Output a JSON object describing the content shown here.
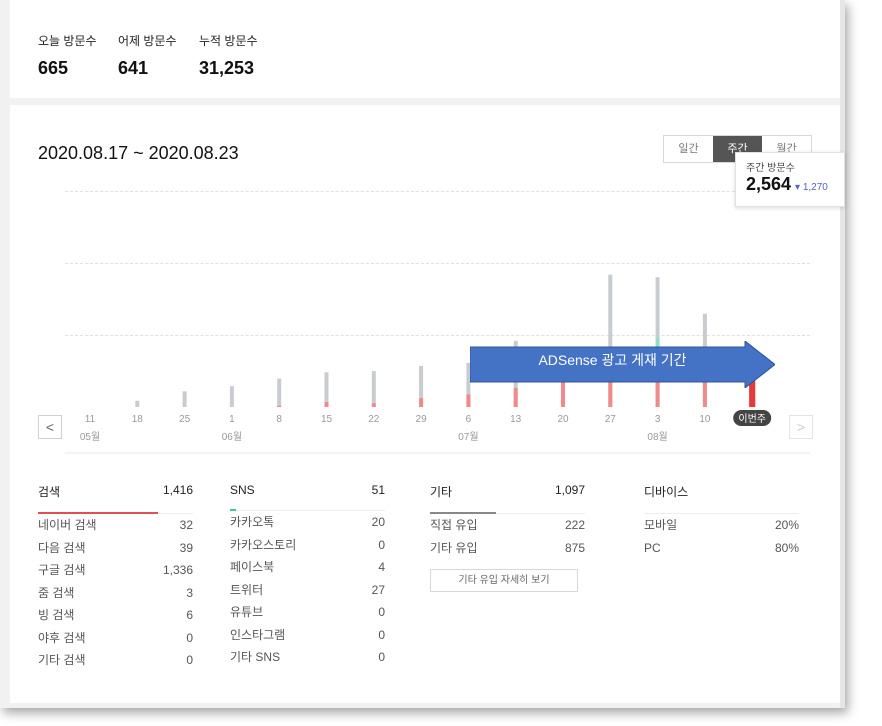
{
  "summary": {
    "today": {
      "label": "오늘 방문수",
      "value": "665"
    },
    "yesterday": {
      "label": "어제 방문수",
      "value": "641"
    },
    "total": {
      "label": "누적 방문수",
      "value": "31,253"
    }
  },
  "period": "2020.08.17 ~ 2020.08.23",
  "period_tabs": [
    "일간",
    "주간",
    "월간"
  ],
  "active_tab": "주간",
  "nav": {
    "prev": "<",
    "next": ">"
  },
  "tooltip": {
    "title": "주간 방문수",
    "value": "2,564",
    "delta": "▾ 1,270"
  },
  "banner": {
    "text": "ADSense 광고 게재 기간",
    "color": "#4472c4"
  },
  "chart_data": {
    "type": "bar",
    "categories": [
      "11",
      "18",
      "25",
      "1",
      "8",
      "15",
      "22",
      "29",
      "6",
      "13",
      "20",
      "27",
      "3",
      "10",
      "이번주"
    ],
    "month_labels": [
      {
        "index": 0,
        "label": "05월"
      },
      {
        "index": 3,
        "label": "06월"
      },
      {
        "index": 8,
        "label": "07월"
      },
      {
        "index": 12,
        "label": "08월"
      }
    ],
    "series": [
      {
        "values": [
          0,
          10,
          25,
          33,
          45,
          55,
          57,
          65,
          70,
          105,
          90,
          210,
          206,
          148,
          92
        ]
      },
      {
        "values": [
          0,
          0,
          0,
          0,
          2,
          8,
          6,
          14,
          20,
          30,
          40,
          66,
          92,
          86,
          66
        ]
      }
    ],
    "teal_values": [
      0,
      0,
      0,
      0,
      0,
      0,
      0,
      0,
      0,
      0,
      0,
      10,
      18,
      3,
      0
    ],
    "colors": {
      "gray": "#c8ccd0",
      "red": "#f08a8a",
      "teal": "#8fe0c6",
      "current_gray": "#9aa0a6",
      "current_red": "#e8393a"
    }
  },
  "categories": [
    {
      "name": "검색",
      "total": "1,416",
      "color": "#e05050",
      "rows": [
        {
          "label": "네이버 검색",
          "value": "32"
        },
        {
          "label": "다음 검색",
          "value": "39"
        },
        {
          "label": "구글 검색",
          "value": "1,336"
        },
        {
          "label": "줌 검색",
          "value": "3"
        },
        {
          "label": "빙 검색",
          "value": "6"
        },
        {
          "label": "야후 검색",
          "value": "0"
        },
        {
          "label": "기타 검색",
          "value": "0"
        }
      ]
    },
    {
      "name": "SNS",
      "total": "51",
      "color": "#3cc89a",
      "rows": [
        {
          "label": "카카오톡",
          "value": "20"
        },
        {
          "label": "카카오스토리",
          "value": "0"
        },
        {
          "label": "페이스북",
          "value": "4"
        },
        {
          "label": "트위터",
          "value": "27"
        },
        {
          "label": "유튜브",
          "value": "0"
        },
        {
          "label": "인스타그램",
          "value": "0"
        },
        {
          "label": "기타 SNS",
          "value": "0"
        }
      ]
    },
    {
      "name": "기타",
      "total": "1,097",
      "color": "#888888",
      "rows": [
        {
          "label": "직접 유입",
          "value": "222"
        },
        {
          "label": "기타 유입",
          "value": "875"
        }
      ],
      "button": "기타 유입 자세히 보기"
    },
    {
      "name": "디바이스",
      "total": "",
      "color": "#dddddd",
      "rows": [
        {
          "label": "모바일",
          "value": "20%"
        },
        {
          "label": "PC",
          "value": "80%"
        }
      ]
    }
  ]
}
